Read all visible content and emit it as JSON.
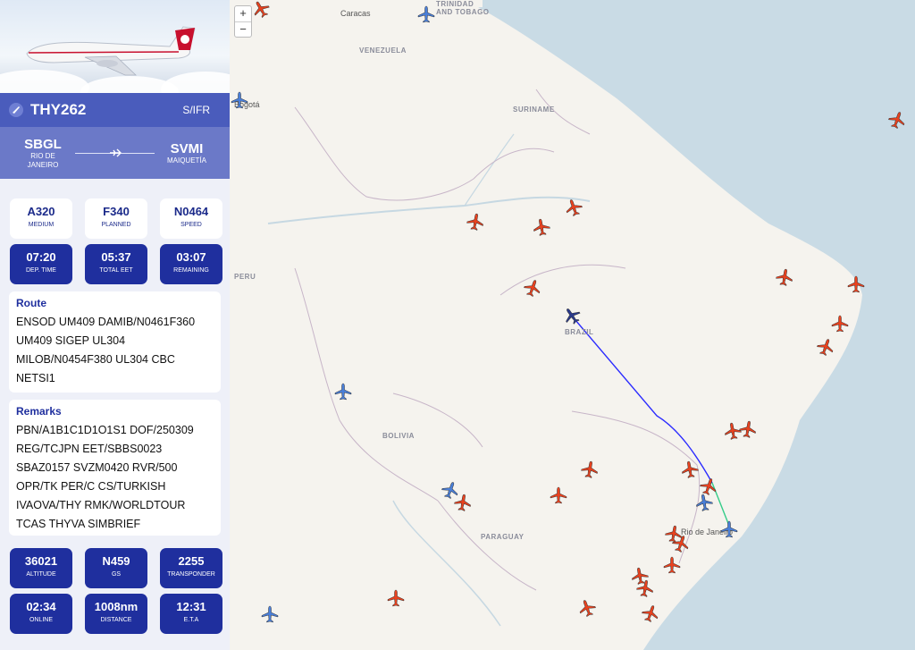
{
  "flight": {
    "callsign": "THY262",
    "rules": "S/IFR",
    "origin": {
      "code": "SBGL",
      "name": "RIO DE\nJANEIRO"
    },
    "destination": {
      "code": "SVMI",
      "name": "MAIQUETÍA"
    }
  },
  "info_tiles": [
    {
      "value": "A320",
      "label": "MEDIUM"
    },
    {
      "value": "F340",
      "label": "PLANNED"
    },
    {
      "value": "N0464",
      "label": "SPEED"
    }
  ],
  "time_tiles": [
    {
      "value": "07:20",
      "label": "DEP. TIME"
    },
    {
      "value": "05:37",
      "label": "TOTAL EET"
    },
    {
      "value": "03:07",
      "label": "REMAINING"
    }
  ],
  "route": {
    "heading": "Route",
    "text": "ENSOD UM409 DAMIB/N0461F360\nUM409 SIGEP UL304\nMILOB/N0454F380 UL304 CBC\nNETSI1"
  },
  "remarks": {
    "heading": "Remarks",
    "text": "PBN/A1B1C1D1O1S1 DOF/250309\nREG/TCJPN EET/SBBS0023\nSBAZ0157 SVZM0420 RVR/500\nOPR/TK PER/C CS/TURKISH\nIVAOVA/THY RMK/WORLDTOUR\nTCAS THYVA SIMBRIEF"
  },
  "stats_row1": [
    {
      "value": "36021",
      "label": "ALTITUDE"
    },
    {
      "value": "N459",
      "label": "GS"
    },
    {
      "value": "2255",
      "label": "TRANSPONDER"
    }
  ],
  "stats_row2": [
    {
      "value": "02:34",
      "label": "ONLINE"
    },
    {
      "value": "1008nm",
      "label": "DISTANCE"
    },
    {
      "value": "12:31",
      "label": "E.T.A"
    }
  ],
  "zoom": {
    "in": "+",
    "out": "−"
  },
  "map_labels": {
    "venezuela": "VENEZUELA",
    "suriname": "SURINAME",
    "peru": "PERU",
    "brazil": "BRAZIL",
    "bolivia": "BOLIVIA",
    "paraguay": "PARAGUAY",
    "trinidad": "TRINIDAD\nAND TOBAGO",
    "caracas": "Caracas",
    "bogota": "Bogotá",
    "rio": "Rio de Janeiro"
  },
  "colors": {
    "accent": "#1f2f9e",
    "traffic": "#e8421f",
    "other_traffic": "#4a7fd8",
    "selected": "#2a3a8c",
    "track": "#2b2bff"
  }
}
